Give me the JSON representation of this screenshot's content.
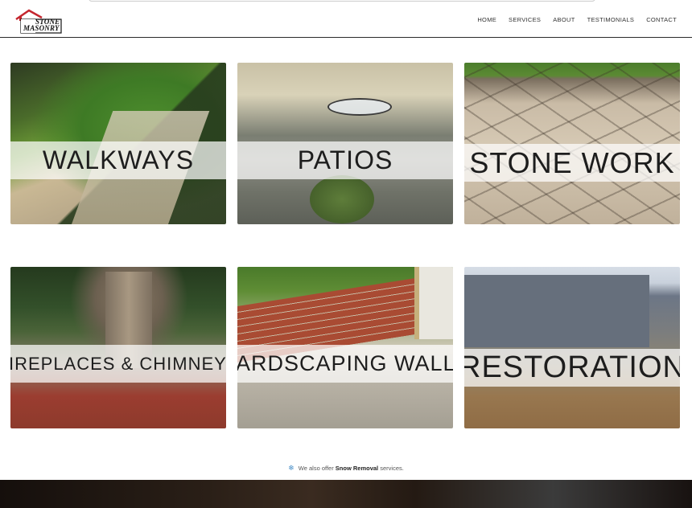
{
  "header": {
    "logo_line1": "STONE",
    "logo_line2": "MASONRY",
    "nav": [
      "HOME",
      "SERVICES",
      "ABOUT",
      "TESTIMONIALS",
      "CONTACT"
    ]
  },
  "tiles": [
    {
      "label": "WALKWAYS"
    },
    {
      "label": "PATIOS"
    },
    {
      "label": "STONE WORK"
    },
    {
      "label": "FIREPLACES & CHIMNEYS"
    },
    {
      "label": "HARDSCAPING WALLS"
    },
    {
      "label": "RESTORATION"
    }
  ],
  "snow": {
    "prefix": "We also offer",
    "link": "Snow Removal",
    "suffix": "services."
  },
  "colors": {
    "logo_red": "#c4262e",
    "flake": "#4a90c8"
  }
}
